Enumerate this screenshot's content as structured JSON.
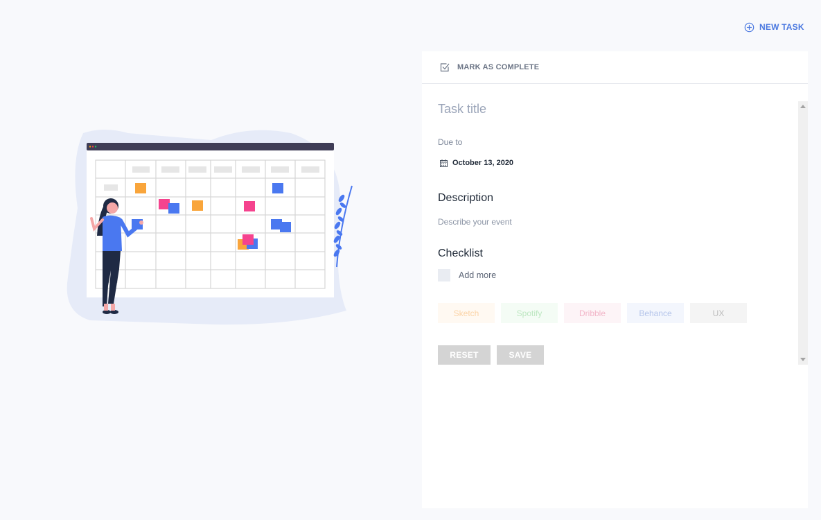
{
  "header": {
    "new_task_label": "NEW TASK",
    "icon": "plus-circle-icon"
  },
  "panel": {
    "mark_complete_label": "MARK AS COMPLETE",
    "task_title_placeholder": "Task title",
    "task_title_value": "",
    "due_label": "Due to",
    "due_date": "October 13, 2020",
    "description_title": "Description",
    "description_placeholder": "Describe your event",
    "description_value": "",
    "checklist_title": "Checklist",
    "add_more_label": "Add more",
    "tags": [
      {
        "label": "Sketch",
        "bg": "#fff9f2",
        "color": "#fbd3a6"
      },
      {
        "label": "Spotify",
        "bg": "#f4fcf5",
        "color": "#bde7c1"
      },
      {
        "label": "Dribble",
        "bg": "#fdf4f7",
        "color": "#f2b5c8"
      },
      {
        "label": "Behance",
        "bg": "#f3f6fd",
        "color": "#b4c4ea"
      },
      {
        "label": "UX",
        "bg": "#f4f4f4",
        "color": "#bcbcbc"
      }
    ],
    "reset_label": "RESET",
    "save_label": "SAVE"
  },
  "colors": {
    "accent": "#4a78e0",
    "background": "#f8f9fc",
    "button_disabled": "#d4d4d4"
  }
}
